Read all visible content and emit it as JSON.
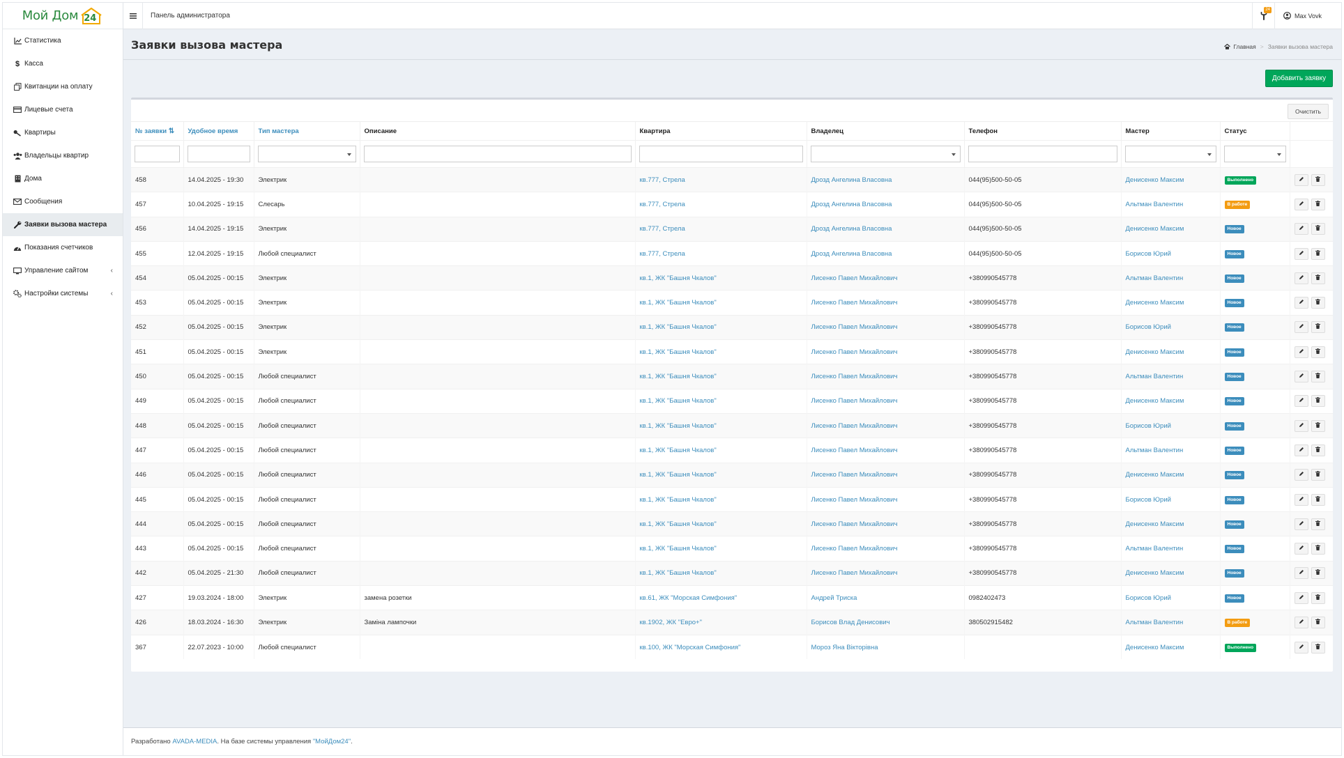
{
  "app": {
    "logo_text": "Мой Дом",
    "logo_number": "24",
    "header_title": "Панель администратора",
    "notifications_count": "24",
    "user_name": "Max Vovk"
  },
  "sidebar": {
    "items": [
      {
        "label": "Статистика",
        "icon": "chart-line-icon"
      },
      {
        "label": "Касса",
        "icon": "dollar-icon"
      },
      {
        "label": "Квитанции на оплату",
        "icon": "copy-icon"
      },
      {
        "label": "Лицевые счета",
        "icon": "credit-card-icon"
      },
      {
        "label": "Квартиры",
        "icon": "key-icon"
      },
      {
        "label": "Владельцы квартир",
        "icon": "users-icon"
      },
      {
        "label": "Дома",
        "icon": "building-icon"
      },
      {
        "label": "Сообщения",
        "icon": "envelope-icon"
      },
      {
        "label": "Заявки вызова мастера",
        "icon": "wrench-icon"
      },
      {
        "label": "Показания счетчиков",
        "icon": "tachometer-icon"
      },
      {
        "label": "Управление сайтом",
        "icon": "desktop-icon"
      },
      {
        "label": "Настройки системы",
        "icon": "cogs-icon"
      }
    ]
  },
  "page": {
    "title": "Заявки вызова мастера",
    "breadcrumb_home": "Главная",
    "breadcrumb_current": "Заявки вызова мастера",
    "add_button": "Добавить заявку",
    "clear_button": "Очистить"
  },
  "table": {
    "columns": [
      "№ заявки",
      "Удобное время",
      "Тип мастера",
      "Описание",
      "Квартира",
      "Владелец",
      "Телефон",
      "Мастер",
      "Статус"
    ],
    "status_colors": {
      "Выполнено": "#00a65a",
      "В работе": "#f39c12",
      "Новое": "#3c8dbc"
    },
    "rows": [
      {
        "id": "458",
        "time": "14.04.2025 - 19:30",
        "type": "Электрик",
        "desc": "",
        "apt": "кв.777, Стрела",
        "owner": "Дрозд Ангелина Власовна",
        "phone": "044(95)500-50-05",
        "master": "Денисенко Максим",
        "status": "Выполнено"
      },
      {
        "id": "457",
        "time": "10.04.2025 - 19:15",
        "type": "Слесарь",
        "desc": "",
        "apt": "кв.777, Стрела",
        "owner": "Дрозд Ангелина Власовна",
        "phone": "044(95)500-50-05",
        "master": "Альтман Валентин",
        "status": "В работе"
      },
      {
        "id": "456",
        "time": "14.04.2025 - 19:15",
        "type": "Электрик",
        "desc": "",
        "apt": "кв.777, Стрела",
        "owner": "Дрозд Ангелина Власовна",
        "phone": "044(95)500-50-05",
        "master": "Денисенко Максим",
        "status": "Новое"
      },
      {
        "id": "455",
        "time": "12.04.2025 - 19:15",
        "type": "Любой специалист",
        "desc": "",
        "apt": "кв.777, Стрела",
        "owner": "Дрозд Ангелина Власовна",
        "phone": "044(95)500-50-05",
        "master": "Борисов Юрий",
        "status": "Новое"
      },
      {
        "id": "454",
        "time": "05.04.2025 - 00:15",
        "type": "Электрик",
        "desc": "",
        "apt": "кв.1, ЖК \"Башня Чкалов\"",
        "owner": "Лисенко Павел Михайлович",
        "phone": "+380990545778",
        "master": "Альтман Валентин",
        "status": "Новое"
      },
      {
        "id": "453",
        "time": "05.04.2025 - 00:15",
        "type": "Электрик",
        "desc": "",
        "apt": "кв.1, ЖК \"Башня Чкалов\"",
        "owner": "Лисенко Павел Михайлович",
        "phone": "+380990545778",
        "master": "Денисенко Максим",
        "status": "Новое"
      },
      {
        "id": "452",
        "time": "05.04.2025 - 00:15",
        "type": "Электрик",
        "desc": "",
        "apt": "кв.1, ЖК \"Башня Чкалов\"",
        "owner": "Лисенко Павел Михайлович",
        "phone": "+380990545778",
        "master": "Борисов Юрий",
        "status": "Новое"
      },
      {
        "id": "451",
        "time": "05.04.2025 - 00:15",
        "type": "Электрик",
        "desc": "",
        "apt": "кв.1, ЖК \"Башня Чкалов\"",
        "owner": "Лисенко Павел Михайлович",
        "phone": "+380990545778",
        "master": "Денисенко Максим",
        "status": "Новое"
      },
      {
        "id": "450",
        "time": "05.04.2025 - 00:15",
        "type": "Любой специалист",
        "desc": "",
        "apt": "кв.1, ЖК \"Башня Чкалов\"",
        "owner": "Лисенко Павел Михайлович",
        "phone": "+380990545778",
        "master": "Альтман Валентин",
        "status": "Новое"
      },
      {
        "id": "449",
        "time": "05.04.2025 - 00:15",
        "type": "Любой специалист",
        "desc": "",
        "apt": "кв.1, ЖК \"Башня Чкалов\"",
        "owner": "Лисенко Павел Михайлович",
        "phone": "+380990545778",
        "master": "Денисенко Максим",
        "status": "Новое"
      },
      {
        "id": "448",
        "time": "05.04.2025 - 00:15",
        "type": "Любой специалист",
        "desc": "",
        "apt": "кв.1, ЖК \"Башня Чкалов\"",
        "owner": "Лисенко Павел Михайлович",
        "phone": "+380990545778",
        "master": "Борисов Юрий",
        "status": "Новое"
      },
      {
        "id": "447",
        "time": "05.04.2025 - 00:15",
        "type": "Любой специалист",
        "desc": "",
        "apt": "кв.1, ЖК \"Башня Чкалов\"",
        "owner": "Лисенко Павел Михайлович",
        "phone": "+380990545778",
        "master": "Альтман Валентин",
        "status": "Новое"
      },
      {
        "id": "446",
        "time": "05.04.2025 - 00:15",
        "type": "Любой специалист",
        "desc": "",
        "apt": "кв.1, ЖК \"Башня Чкалов\"",
        "owner": "Лисенко Павел Михайлович",
        "phone": "+380990545778",
        "master": "Денисенко Максим",
        "status": "Новое"
      },
      {
        "id": "445",
        "time": "05.04.2025 - 00:15",
        "type": "Любой специалист",
        "desc": "",
        "apt": "кв.1, ЖК \"Башня Чкалов\"",
        "owner": "Лисенко Павел Михайлович",
        "phone": "+380990545778",
        "master": "Борисов Юрий",
        "status": "Новое"
      },
      {
        "id": "444",
        "time": "05.04.2025 - 00:15",
        "type": "Любой специалист",
        "desc": "",
        "apt": "кв.1, ЖК \"Башня Чкалов\"",
        "owner": "Лисенко Павел Михайлович",
        "phone": "+380990545778",
        "master": "Денисенко Максим",
        "status": "Новое"
      },
      {
        "id": "443",
        "time": "05.04.2025 - 00:15",
        "type": "Любой специалист",
        "desc": "",
        "apt": "кв.1, ЖК \"Башня Чкалов\"",
        "owner": "Лисенко Павел Михайлович",
        "phone": "+380990545778",
        "master": "Альтман Валентин",
        "status": "Новое"
      },
      {
        "id": "442",
        "time": "05.04.2025 - 21:30",
        "type": "Любой специалист",
        "desc": "",
        "apt": "кв.1, ЖК \"Башня Чкалов\"",
        "owner": "Лисенко Павел Михайлович",
        "phone": "+380990545778",
        "master": "Денисенко Максим",
        "status": "Новое"
      },
      {
        "id": "427",
        "time": "19.03.2024 - 18:00",
        "type": "Электрик",
        "desc": "замена розетки",
        "apt": "кв.61, ЖК \"Морская Симфония\"",
        "owner": "Андрей Триска",
        "phone": "0982402473",
        "master": "Борисов Юрий",
        "status": "Новое"
      },
      {
        "id": "426",
        "time": "18.03.2024 - 16:30",
        "type": "Электрик",
        "desc": "Заміна лампочки",
        "apt": "кв.1902, ЖК \"Евро+\"",
        "owner": "Борисов Влад Денисович",
        "phone": "380502915482",
        "master": "Альтман Валентин",
        "status": "В работе"
      },
      {
        "id": "367",
        "time": "22.07.2023 - 10:00",
        "type": "Любой специалист",
        "desc": "",
        "apt": "кв.100, ЖК \"Морская Симфония\"",
        "owner": "Мороз Яна Вікторівна",
        "phone": "",
        "master": "Денисенко Максим",
        "status": "Выполнено"
      }
    ]
  },
  "footer": {
    "prefix": "Разработано ",
    "company": "AVADA-MEDIA",
    "middle": ". На базе системы управления ",
    "system": "\"МойДом24\"",
    "suffix": "."
  }
}
